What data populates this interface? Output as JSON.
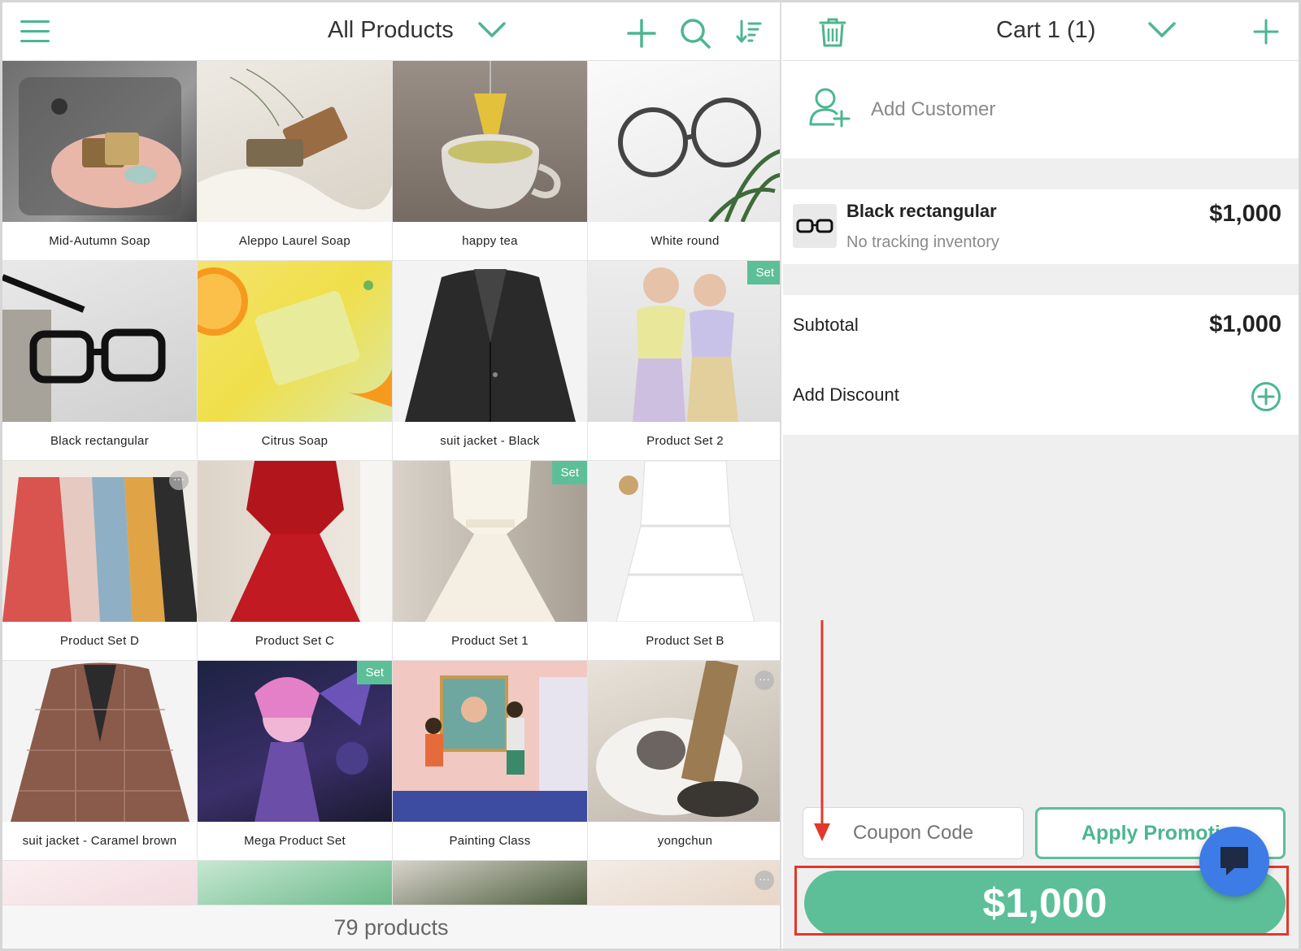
{
  "left_header": {
    "title": "All Products"
  },
  "products": [
    {
      "name": "Mid-Autumn Soap",
      "badge": "",
      "more": false
    },
    {
      "name": "Aleppo Laurel Soap",
      "badge": "",
      "more": false
    },
    {
      "name": "happy tea",
      "badge": "",
      "more": false
    },
    {
      "name": "White round",
      "badge": "",
      "more": false
    },
    {
      "name": "Black rectangular",
      "badge": "",
      "more": false
    },
    {
      "name": "Citrus Soap",
      "badge": "",
      "more": false
    },
    {
      "name": "suit jacket - Black",
      "badge": "",
      "more": false
    },
    {
      "name": "Product Set 2",
      "badge": "Set",
      "more": false
    },
    {
      "name": "Product Set D",
      "badge": "",
      "more": true
    },
    {
      "name": "Product Set C",
      "badge": "",
      "more": false
    },
    {
      "name": "Product Set 1",
      "badge": "Set",
      "more": false
    },
    {
      "name": "Product Set B",
      "badge": "",
      "more": false
    },
    {
      "name": "suit jacket - Caramel brown",
      "badge": "",
      "more": false
    },
    {
      "name": "Mega Product Set",
      "badge": "Set",
      "more": false
    },
    {
      "name": "Painting Class",
      "badge": "",
      "more": false
    },
    {
      "name": "yongchun",
      "badge": "",
      "more": true
    }
  ],
  "footer": {
    "count": "79 products"
  },
  "cart_header": {
    "title": "Cart 1 (1)"
  },
  "customer": {
    "label": "Add Customer"
  },
  "cart_items": [
    {
      "name": "Black rectangular",
      "subtitle": "No tracking inventory",
      "price": "$1,000"
    }
  ],
  "totals": {
    "subtotal_label": "Subtotal",
    "subtotal_value": "$1,000",
    "discount_label": "Add Discount"
  },
  "coupon": {
    "placeholder": "Coupon Code"
  },
  "promo_button": {
    "label": "Apply Promoti"
  },
  "pay_button": {
    "label": "$1,000"
  },
  "colors": {
    "accent": "#5cbf98",
    "accent_dark": "#4cb68f",
    "highlight": "#e0392b",
    "chat": "#3d7be6"
  },
  "icons": [
    "menu-icon",
    "chevron-down-icon",
    "plus-icon",
    "search-icon",
    "sort-icon",
    "trash-icon",
    "add-user-icon",
    "plus-circle-icon",
    "chat-icon"
  ]
}
